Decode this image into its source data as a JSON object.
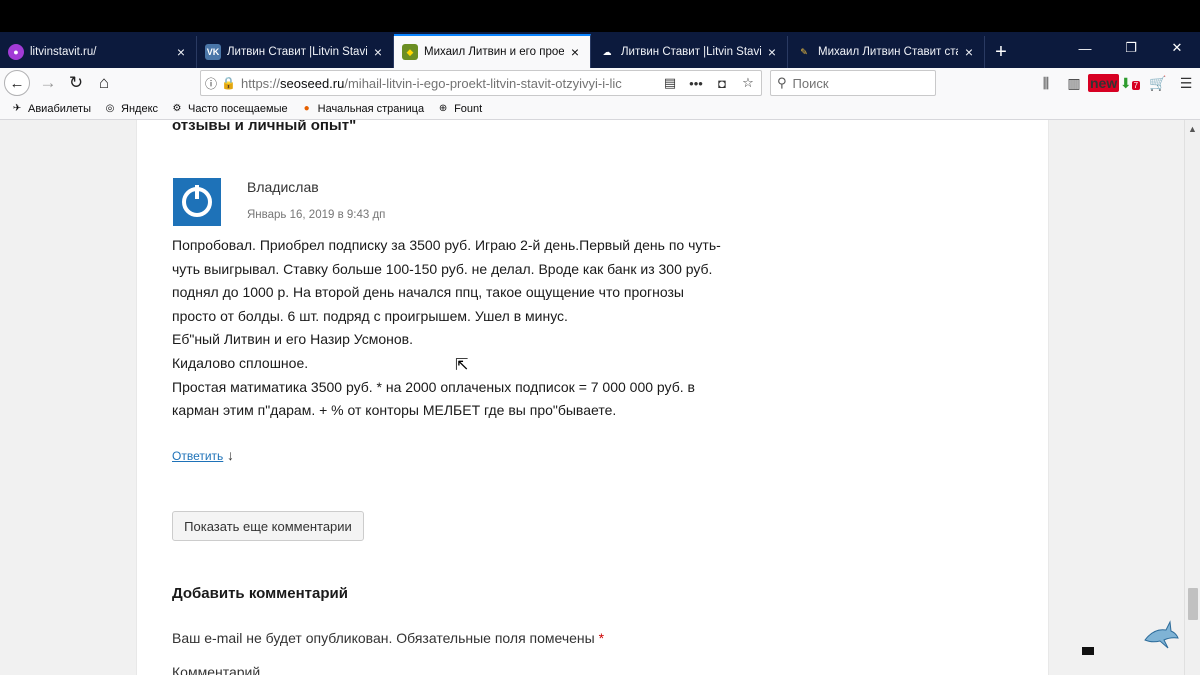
{
  "tabs": [
    {
      "favicon": "litvinstavit-favicon",
      "title": "litvinstavit.ru/",
      "active": false
    },
    {
      "favicon": "vk-icon",
      "title": "Литвин Ставит |Litvin Stavit| Пр",
      "active": false
    },
    {
      "favicon": "shield-favicon",
      "title": "Михаил Литвин и его проект «",
      "active": true
    },
    {
      "favicon": "cloud-favicon",
      "title": "Литвин Ставит |Litvin Stavit| Пр",
      "active": false
    },
    {
      "favicon": "pen-favicon",
      "title": "Михаил Литвин Ставит ставки",
      "active": false
    }
  ],
  "navbar": {
    "url_prefix": "https://",
    "url_domain": "seoseed.ru",
    "url_path": "/mihail-litvin-i-ego-proekt-litvin-stavit-otzyivyi-i-lic",
    "search_placeholder": "Поиск",
    "badge_new": "new",
    "badge_count": "7"
  },
  "bookmarks": [
    {
      "icon": "folder-icon",
      "label": "Авиабилеты"
    },
    {
      "icon": "yandex-icon",
      "label": "Яндекс"
    },
    {
      "icon": "gear-icon",
      "label": "Часто посещаемые"
    },
    {
      "icon": "firefox-icon",
      "label": "Начальная страница"
    },
    {
      "icon": "globe-icon",
      "label": "Fount"
    }
  ],
  "page": {
    "heading_cut": "отзывы и личный опыт\"",
    "comment": {
      "author": "Владислав",
      "date": "Январь 16, 2019 в 9:43 дп",
      "lines": [
        "Попробовал. Приобрел подписку за 3500 руб. Играю 2-й день.Первый день по чуть-",
        "чуть выигрывал. Ставку больше 100-150 руб. не делал. Вроде как банк из 300 руб.",
        "поднял до 1000 р. На второй день начался ппц, такое ощущение что прогнозы",
        "просто от болды. 6 шт. подряд с проигрышем. Ушел в минус.",
        "Еб\"ный Литвин и его Назир Усмонов.",
        "Кидалово сплошное.",
        "Простая матиматика 3500 руб. * на 2000 оплаченых подписок = 7 000 000 руб. в",
        "карман этим п\"дарам. + % от конторы МЕЛБЕТ где вы про\"бываете."
      ],
      "reply_label": "Ответить",
      "reply_arrow": "↓"
    },
    "more_comments_label": "Показать еще комментарии",
    "add_comment_heading": "Добавить комментарий",
    "notice_text": "Ваш e-mail не будет опубликован. Обязательные поля помечены",
    "notice_required": "*",
    "comment_field_label": "Комментарий"
  },
  "colors": {
    "tabstrip": "#0c1a3d",
    "accent": "#0a84ff",
    "avatar": "#1e72b8",
    "link": "#1e72b8"
  }
}
